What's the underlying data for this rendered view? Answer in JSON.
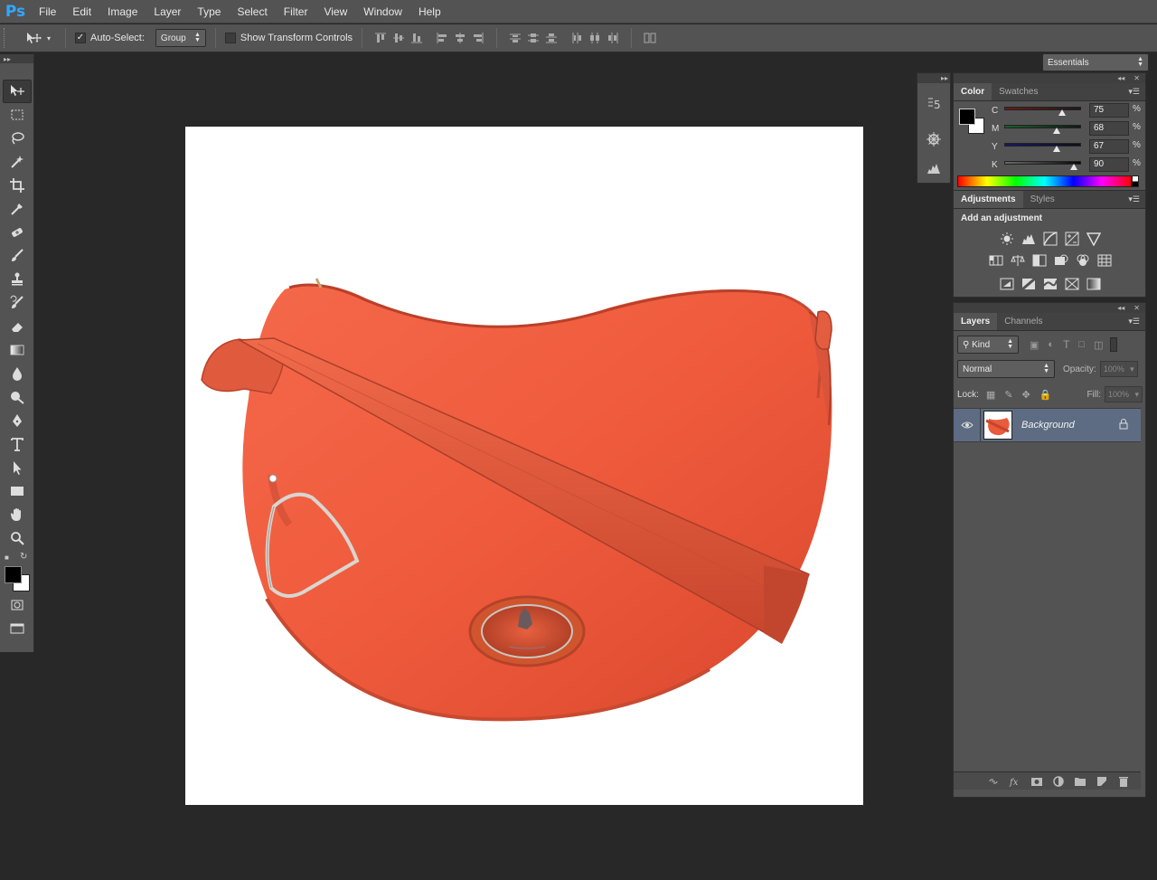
{
  "app": {
    "logo": "Ps"
  },
  "menu": [
    "File",
    "Edit",
    "Image",
    "Layer",
    "Type",
    "Select",
    "Filter",
    "View",
    "Window",
    "Help"
  ],
  "options": {
    "auto_select_label": "Auto-Select:",
    "auto_select_checked": true,
    "auto_select_target": "Group",
    "show_transform_label": "Show Transform Controls",
    "show_transform_checked": false,
    "workspace": "Essentials"
  },
  "toolbar": {
    "tools": [
      "move-tool",
      "rectangular-marquee-tool",
      "lasso-tool",
      "magic-wand-tool",
      "crop-tool",
      "eyedropper-tool",
      "spot-healing-brush-tool",
      "brush-tool",
      "clone-stamp-tool",
      "history-brush-tool",
      "eraser-tool",
      "gradient-tool",
      "blur-tool",
      "dodge-tool",
      "pen-tool",
      "type-tool",
      "path-selection-tool",
      "rectangle-tool",
      "hand-tool",
      "zoom-tool"
    ],
    "active_tool": "move-tool",
    "foreground_color": "#000000",
    "background_color": "#ffffff"
  },
  "color_panel": {
    "tabs": [
      "Color",
      "Swatches"
    ],
    "active_tab": "Color",
    "channels": [
      {
        "label": "C",
        "value": "75",
        "unit": "%"
      },
      {
        "label": "M",
        "value": "68",
        "unit": "%"
      },
      {
        "label": "Y",
        "value": "67",
        "unit": "%"
      },
      {
        "label": "K",
        "value": "90",
        "unit": "%"
      }
    ]
  },
  "adjustments_panel": {
    "tabs": [
      "Adjustments",
      "Styles"
    ],
    "active_tab": "Adjustments",
    "heading": "Add an adjustment",
    "rows": [
      [
        "brightness-contrast-icon",
        "levels-icon",
        "curves-icon",
        "exposure-icon",
        "vibrance-icon"
      ],
      [
        "hue-saturation-icon",
        "color-balance-icon",
        "black-white-icon",
        "photo-filter-icon",
        "channel-mixer-icon",
        "color-lookup-icon"
      ],
      [
        "invert-icon",
        "posterize-icon",
        "threshold-icon",
        "selective-color-icon",
        "gradient-map-icon"
      ]
    ]
  },
  "layers_panel": {
    "tabs": [
      "Layers",
      "Channels"
    ],
    "active_tab": "Layers",
    "filter_kind": "Kind",
    "blend_mode": "Normal",
    "opacity_label": "Opacity:",
    "opacity_value": "100%",
    "lock_label": "Lock:",
    "fill_label": "Fill:",
    "fill_value": "100%",
    "layers": [
      {
        "name": "Background",
        "visible": true,
        "locked": true,
        "selected": true
      }
    ]
  }
}
